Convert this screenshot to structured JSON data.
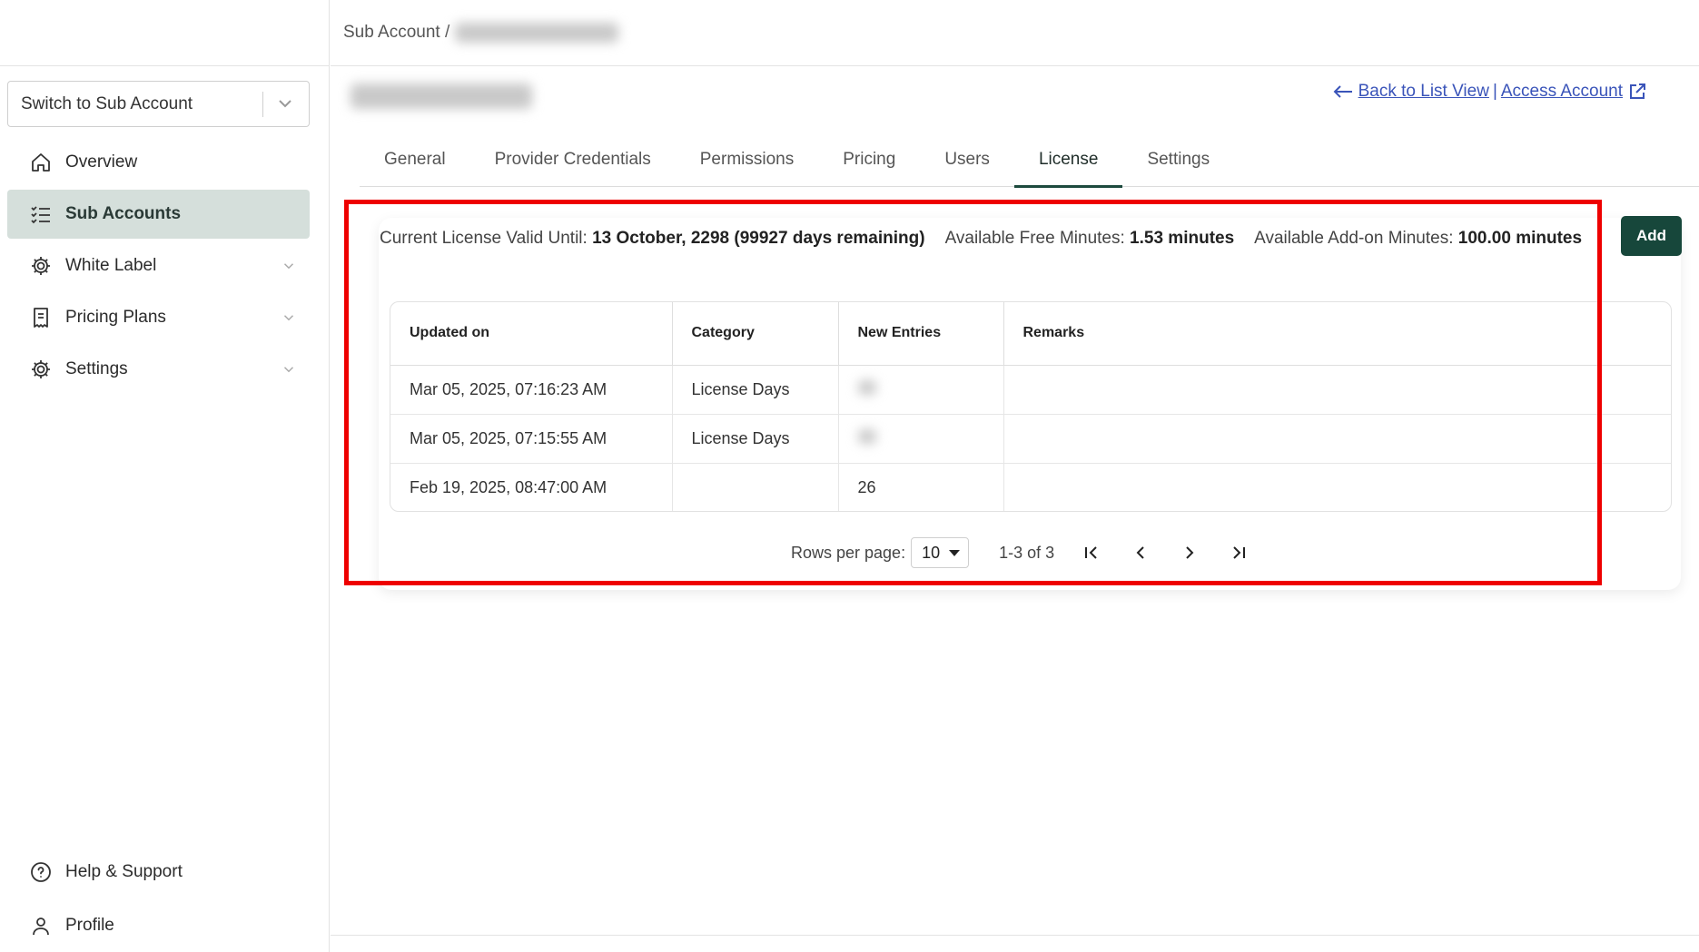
{
  "sidebar": {
    "switch_placeholder": "Switch to Sub Account",
    "items": [
      {
        "label": "Overview",
        "icon": "home-icon"
      },
      {
        "label": "Sub Accounts",
        "icon": "list-icon"
      },
      {
        "label": "White Label",
        "icon": "gear-icon"
      },
      {
        "label": "Pricing Plans",
        "icon": "receipt-icon"
      },
      {
        "label": "Settings",
        "icon": "gear-icon"
      }
    ],
    "bottom": [
      {
        "label": "Help & Support",
        "icon": "help-icon"
      },
      {
        "label": "Profile",
        "icon": "user-icon"
      }
    ]
  },
  "breadcrumb": {
    "root": "Sub Account /"
  },
  "links": {
    "back": "Back to List View",
    "separator": "|",
    "access": "Access Account"
  },
  "tabs": [
    "General",
    "Provider Credentials",
    "Permissions",
    "Pricing",
    "Users",
    "License",
    "Settings"
  ],
  "active_tab": "License",
  "license": {
    "valid_label": "Current License Valid Until:",
    "valid_value": "13 October, 2298 (99927 days remaining)",
    "free_label": "Available Free Minutes:",
    "free_value": "1.53 minutes",
    "addon_label": "Available Add-on Minutes:",
    "addon_value": "100.00 minutes",
    "add_button": "Add"
  },
  "table": {
    "headers": [
      "Updated on",
      "Category",
      "New Entries",
      "Remarks"
    ],
    "rows": [
      {
        "updated": "Mar 05, 2025, 07:16:23 AM",
        "category": "License Days",
        "entries": "",
        "remarks": ""
      },
      {
        "updated": "Mar 05, 2025, 07:15:55 AM",
        "category": "License Days",
        "entries": "",
        "remarks": ""
      },
      {
        "updated": "Feb 19, 2025, 08:47:00 AM",
        "category": "",
        "entries": "26",
        "remarks": ""
      }
    ]
  },
  "pagination": {
    "rows_label": "Rows per page:",
    "rows_value": "10",
    "range": "1-3 of 3"
  },
  "colors": {
    "accent": "#17473b",
    "active_nav_bg": "#d5dfdb",
    "link": "#3a54b9",
    "highlight": "#ee0000"
  }
}
